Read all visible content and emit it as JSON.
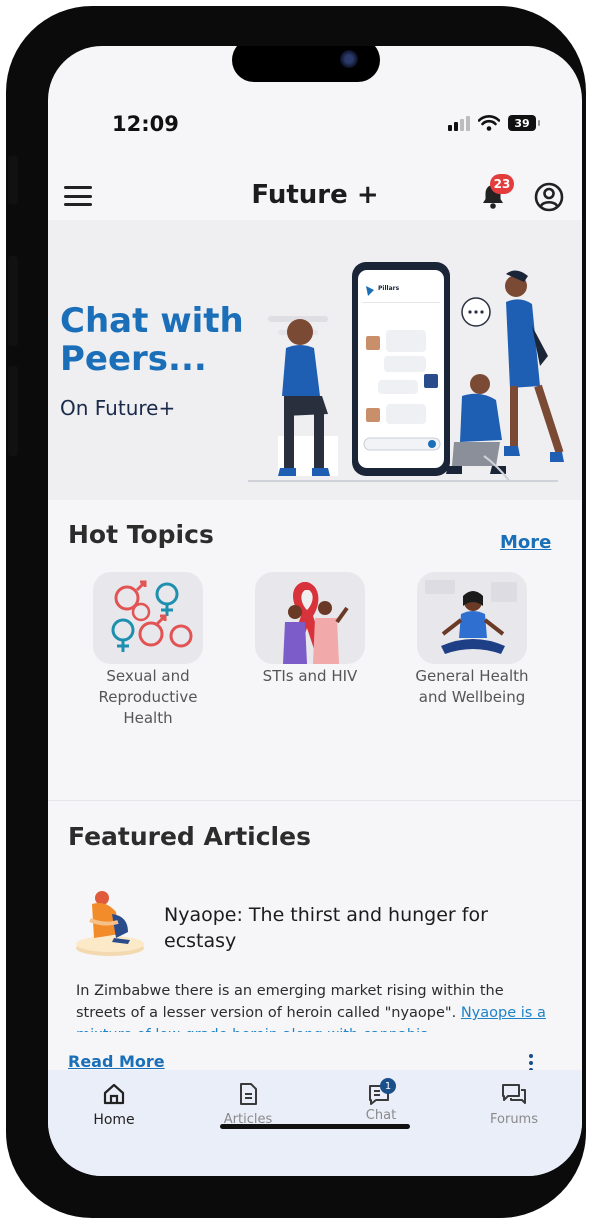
{
  "status_bar": {
    "time": "12:09",
    "battery": "39"
  },
  "app_bar": {
    "title": "Future +",
    "notification_count": "23"
  },
  "hero": {
    "title": "Chat with Peers...",
    "subtitle": "On Future+",
    "mock_app_name": "Pillars"
  },
  "hot_topics": {
    "title": "Hot Topics",
    "more": "More",
    "items": [
      {
        "label": "Sexual and Reproductive Health"
      },
      {
        "label": "STIs and HIV"
      },
      {
        "label": "General  Health and Wellbeing"
      }
    ]
  },
  "featured": {
    "title": "Featured Articles",
    "article": {
      "title": "Nyaope: The thirst and hunger for ecstasy",
      "body_text": "In Zimbabwe there is an emerging market rising within the streets of a lesser version of heroin called \"nyaope\". ",
      "body_link": "Nyaope is a mixture of low-grade heroin along with cannabis",
      "read_more": "Read More"
    }
  },
  "bottom_nav": {
    "items": [
      {
        "label": "Home",
        "icon": "home-icon",
        "active": true
      },
      {
        "label": "Articles",
        "icon": "document-icon"
      },
      {
        "label": "Chat",
        "icon": "chat-icon",
        "badge": "1"
      },
      {
        "label": "Forums",
        "icon": "forum-icon"
      }
    ]
  },
  "colors": {
    "accent": "#1a6fb8",
    "badge": "#e23c3c",
    "nav_bg": "#e9eef8"
  }
}
